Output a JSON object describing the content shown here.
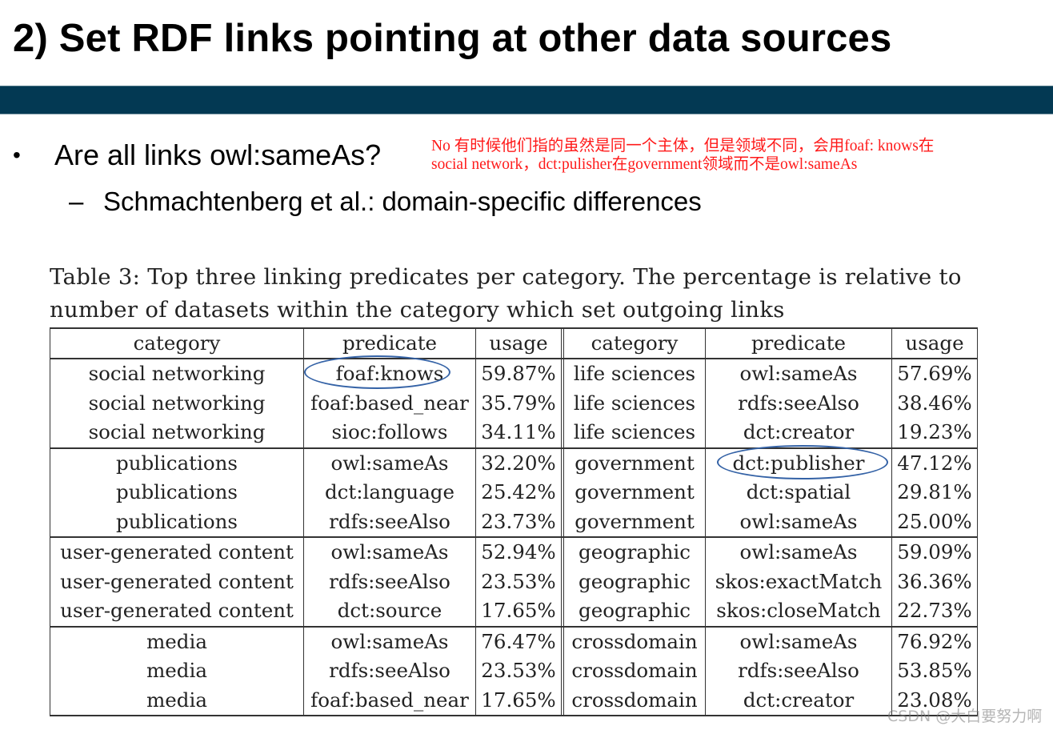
{
  "slide": {
    "title": "2) Set RDF links pointing at other data sources",
    "header_band_color": "#033953",
    "bullet": {
      "marker": "•",
      "text": "Are all links owl:sameAs?"
    },
    "sub_bullet": {
      "marker": "–",
      "text": "Schmachtenberg et al.: domain-specific differences"
    },
    "annotation": {
      "color": "#ff1a1a",
      "line1": "No 有时候他们指的虽然是同一个主体，但是领域不同，会用foaf: knows在",
      "line2": "social network，dct:pulisher在government领域而不是owl:sameAs"
    },
    "table_caption": {
      "line1": "Table 3: Top three linking predicates per category. The percentage is relative to",
      "line2": "number of datasets within the category which set outgoing links"
    },
    "table": {
      "headers": [
        "category",
        "predicate",
        "usage",
        "category",
        "predicate",
        "usage"
      ],
      "groups": [
        {
          "rows": [
            [
              "social networking",
              "foaf:knows",
              "59.87%",
              "life sciences",
              "owl:sameAs",
              "57.69%"
            ],
            [
              "social networking",
              "foaf:based_near",
              "35.79%",
              "life sciences",
              "rdfs:seeAlso",
              "38.46%"
            ],
            [
              "social networking",
              "sioc:follows",
              "34.11%",
              "life sciences",
              "dct:creator",
              "19.23%"
            ]
          ]
        },
        {
          "rows": [
            [
              "publications",
              "owl:sameAs",
              "32.20%",
              "government",
              "dct:publisher",
              "47.12%"
            ],
            [
              "publications",
              "dct:language",
              "25.42%",
              "government",
              "dct:spatial",
              "29.81%"
            ],
            [
              "publications",
              "rdfs:seeAlso",
              "23.73%",
              "government",
              "owl:sameAs",
              "25.00%"
            ]
          ]
        },
        {
          "rows": [
            [
              "user-generated content",
              "owl:sameAs",
              "52.94%",
              "geographic",
              "owl:sameAs",
              "59.09%"
            ],
            [
              "user-generated content",
              "rdfs:seeAlso",
              "23.53%",
              "geographic",
              "skos:exactMatch",
              "36.36%"
            ],
            [
              "user-generated content",
              "dct:source",
              "17.65%",
              "geographic",
              "skos:closeMatch",
              "22.73%"
            ]
          ]
        },
        {
          "rows": [
            [
              "media",
              "owl:sameAs",
              "76.47%",
              "crossdomain",
              "owl:sameAs",
              "76.92%"
            ],
            [
              "media",
              "rdfs:seeAlso",
              "23.53%",
              "crossdomain",
              "rdfs:seeAlso",
              "53.85%"
            ],
            [
              "media",
              "foaf:based_near",
              "17.65%",
              "crossdomain",
              "dct:creator",
              "23.08%"
            ]
          ]
        }
      ],
      "highlighted_cells": [
        "foaf:knows",
        "dct:publisher"
      ],
      "highlight_color": "#3462a6"
    },
    "watermark": "CSDN @大白要努力啊"
  }
}
